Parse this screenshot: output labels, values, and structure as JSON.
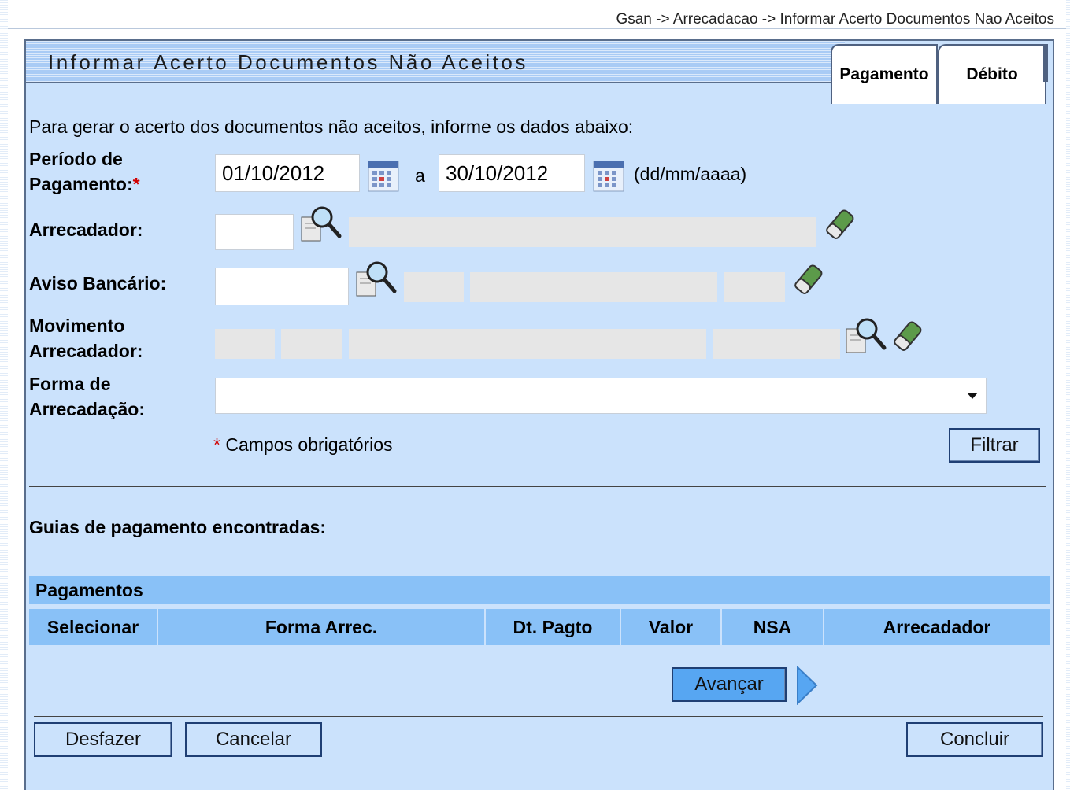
{
  "breadcrumb": "Gsan -> Arrecadacao -> Informar Acerto Documentos Nao Aceitos",
  "title": "Informar Acerto Documentos Não Aceitos",
  "tabs": [
    {
      "label": "Pagamento",
      "active": true
    },
    {
      "label": "Débito",
      "active": false
    }
  ],
  "intro": "Para gerar o acerto dos documentos não aceitos, informe os dados abaixo:",
  "form": {
    "periodo_label_1": "Período de",
    "periodo_label_2": "Pagamento:",
    "required_mark": "*",
    "periodo_inicio": "01/10/2012",
    "periodo_sep": "a",
    "periodo_fim": "30/10/2012",
    "date_format": "(dd/mm/aaaa)",
    "arrecadador_label": "Arrecadador:",
    "aviso_label": "Aviso Bancário:",
    "movimento_label_1": "Movimento",
    "movimento_label_2": "Arrecadador:",
    "forma_label_1": "Forma de",
    "forma_label_2": "Arrecadação:",
    "forma_value": "",
    "required_note": "Campos obrigatórios",
    "filtrar_button": "Filtrar"
  },
  "results": {
    "heading": "Guias de pagamento encontradas:",
    "table_title": "Pagamentos",
    "columns": [
      "Selecionar",
      "Forma Arrec.",
      "Dt. Pagto",
      "Valor",
      "NSA",
      "Arrecadador"
    ],
    "rows": []
  },
  "buttons": {
    "avancar": "Avançar",
    "desfazer": "Desfazer",
    "cancelar": "Cancelar",
    "concluir": "Concluir"
  },
  "colors": {
    "panel_bg": "#cbe2fc",
    "header_blue": "#89c1f7",
    "button_blue": "#57a6f2",
    "required_red": "#d10000"
  }
}
